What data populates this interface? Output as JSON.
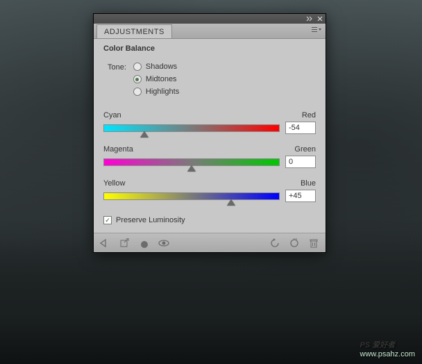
{
  "panel": {
    "tab_label": "ADJUSTMENTS",
    "title": "Color Balance",
    "tone_label": "Tone:",
    "tone_options": {
      "shadows": "Shadows",
      "midtones": "Midtones",
      "highlights": "Highlights"
    },
    "tone_selected": "midtones",
    "sliders": {
      "cyan_red": {
        "left": "Cyan",
        "right": "Red",
        "value": "-54",
        "percent": 23
      },
      "magenta_green": {
        "left": "Magenta",
        "right": "Green",
        "value": "0",
        "percent": 50
      },
      "yellow_blue": {
        "left": "Yellow",
        "right": "Blue",
        "value": "+45",
        "percent": 72.5
      }
    },
    "preserve_label": "Preserve Luminosity",
    "preserve_checked": true
  },
  "watermark": {
    "main": "PS 爱好者",
    "sub": "www.psahz.com"
  }
}
